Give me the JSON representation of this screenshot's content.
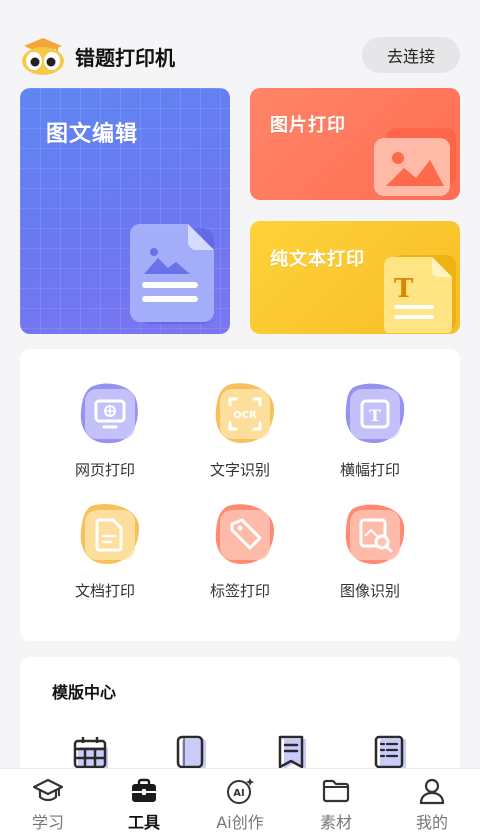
{
  "header": {
    "title": "错题打印机",
    "connect_label": "去连接"
  },
  "cards": {
    "edit": {
      "title": "图文编辑",
      "icon": "image-doc-icon"
    },
    "photo": {
      "title": "图片打印",
      "icon": "picture-icon"
    },
    "text": {
      "title": "纯文本打印",
      "icon": "text-doc-icon"
    }
  },
  "tools": [
    {
      "label": "网页打印",
      "icon": "webpage-icon",
      "color": "#8a86f0"
    },
    {
      "label": "文字识别",
      "icon": "ocr-icon",
      "color": "#f6b94a"
    },
    {
      "label": "横幅打印",
      "icon": "banner-text-icon",
      "color": "#8a86f0"
    },
    {
      "label": "文档打印",
      "icon": "document-icon",
      "color": "#f6b94a"
    },
    {
      "label": "标签打印",
      "icon": "tag-icon",
      "color": "#ff7d62"
    },
    {
      "label": "图像识别",
      "icon": "image-search-icon",
      "color": "#ff7d62"
    }
  ],
  "templates": {
    "title": "模版中心",
    "items": [
      {
        "icon": "calendar-icon"
      },
      {
        "icon": "notebook-icon"
      },
      {
        "icon": "bookmark-icon"
      },
      {
        "icon": "list-icon"
      }
    ]
  },
  "tabbar": {
    "active": "工具",
    "items": [
      {
        "label": "学习",
        "icon": "graduation-cap-icon"
      },
      {
        "label": "工具",
        "icon": "toolbox-icon"
      },
      {
        "label": "Ai创作",
        "icon": "ai-sparkle-icon"
      },
      {
        "label": "素材",
        "icon": "folder-icon"
      },
      {
        "label": "我的",
        "icon": "user-icon"
      }
    ]
  },
  "colors": {
    "accent_blue": "#6b78f0",
    "accent_red": "#ff6e52",
    "accent_yellow": "#f7bd26"
  }
}
